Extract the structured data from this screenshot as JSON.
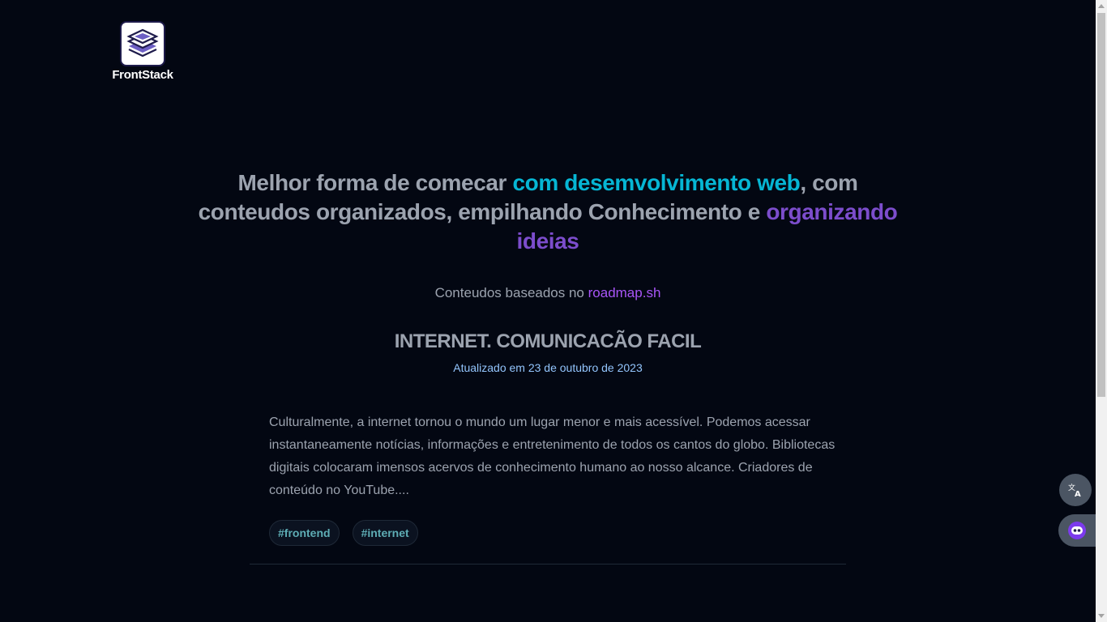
{
  "logo": {
    "text": "FrontStack"
  },
  "hero": {
    "title_part1": "Melhor forma de comecar ",
    "title_highlight1": "com desemvolvimento web",
    "title_part2": ", com conteudos organizados, empilhando Conhecimento e ",
    "title_highlight2": "organizando ideias",
    "subtitle_prefix": "Conteudos baseados no ",
    "subtitle_link": "roadmap.sh"
  },
  "post": {
    "title": "INTERNET. COMUNICACÃO FACIL",
    "date": "Atualizado em 23 de outubro de 2023",
    "excerpt": "Culturalmente, a internet tornou o mundo um lugar menor e mais acessível. Podemos acessar instantaneamente notícias, informações e entretenimento de todos os cantos do globo. Bibliotecas digitais colocaram imensos acervos de conhecimento humano ao nosso alcance. Criadores de conteúdo no YouTube....",
    "tags": [
      "#frontend",
      "#internet"
    ]
  },
  "widgets": {
    "translate_icon": "translate-icon",
    "assistant_icon": "assistant-face-icon"
  },
  "colors": {
    "background": "#030712",
    "text_muted": "#9ca3af",
    "highlight_cyan": "#06b6d4",
    "highlight_purple": "#7c4dcc",
    "link_purple": "#a855f7",
    "date_blue": "#93c5fd",
    "tag_text": "#5eadb5"
  }
}
